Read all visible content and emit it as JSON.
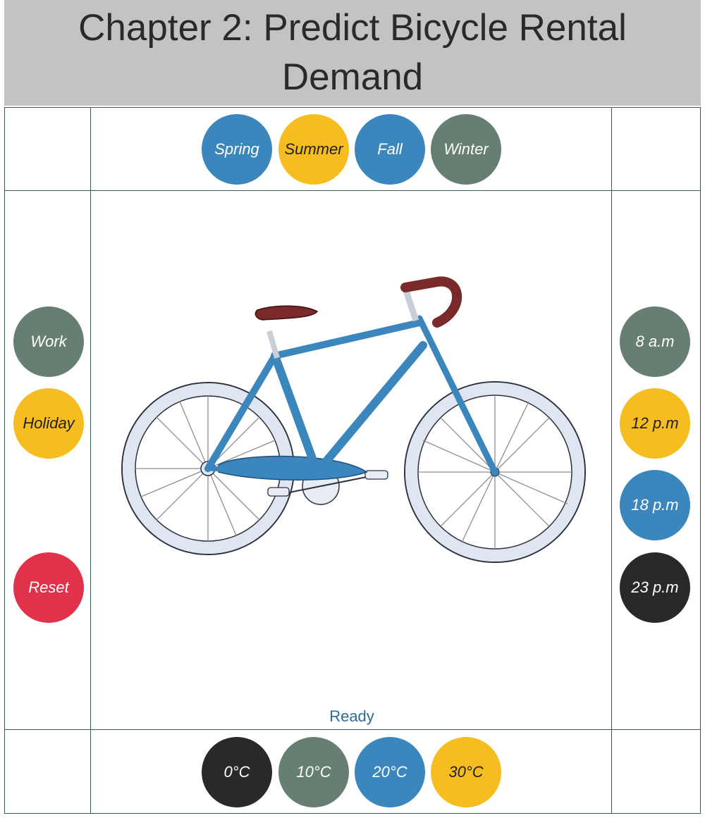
{
  "title": "Chapter 2: Predict Bicycle Rental Demand",
  "seasons": [
    {
      "label": "Spring",
      "color": "#3a86bd"
    },
    {
      "label": "Summer",
      "color": "#f6bd21"
    },
    {
      "label": "Fall",
      "color": "#3a86bd"
    },
    {
      "label": "Winter",
      "color": "#677f72"
    }
  ],
  "day_types": [
    {
      "label": "Work",
      "color": "#677f72"
    },
    {
      "label": "Holiday",
      "color": "#f6bd21"
    }
  ],
  "reset_label": "Reset",
  "hours": [
    {
      "label": "8 a.m",
      "color": "#677f72"
    },
    {
      "label": "12 p.m",
      "color": "#f6bd21"
    },
    {
      "label": "18 p.m",
      "color": "#3a86bd"
    },
    {
      "label": "23 p.m",
      "color": "#2b2927"
    }
  ],
  "temperatures": [
    {
      "label": "0°C",
      "color": "#2b2927"
    },
    {
      "label": "10°C",
      "color": "#677f72"
    },
    {
      "label": "20°C",
      "color": "#3a86bd"
    },
    {
      "label": "30°C",
      "color": "#f6bd21"
    }
  ],
  "status": "Ready",
  "illustration": "bicycle-illustration"
}
